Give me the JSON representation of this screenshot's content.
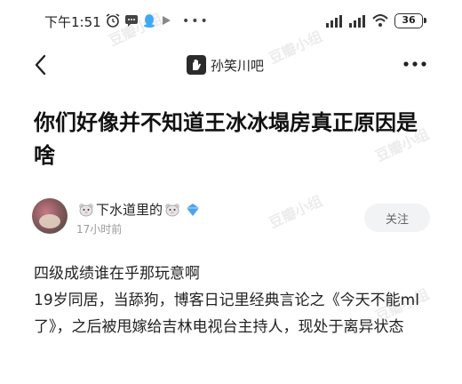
{
  "status_bar": {
    "time": "下午1:51",
    "battery": "36"
  },
  "nav": {
    "forum_name": "孙笑川吧"
  },
  "post": {
    "title": "你们好像并不知道王冰冰塌房真正原因是啥",
    "author": {
      "name": "下水道里的",
      "time": "17小时前"
    },
    "follow_label": "关注",
    "body": [
      "四级成绩谁在乎那玩意啊",
      "19岁同居，当舔狗，博客日记里经典言论之《今天不能ml了》，之后被甩嫁给吉林电视台主持人，现处于离异状态"
    ]
  },
  "watermark": "豆瓣小组",
  "colors": {
    "text": "#1a1a1a",
    "muted": "#9a9a9a",
    "follow_bg": "#f2f3f5",
    "verify": "#4aa3f0"
  }
}
